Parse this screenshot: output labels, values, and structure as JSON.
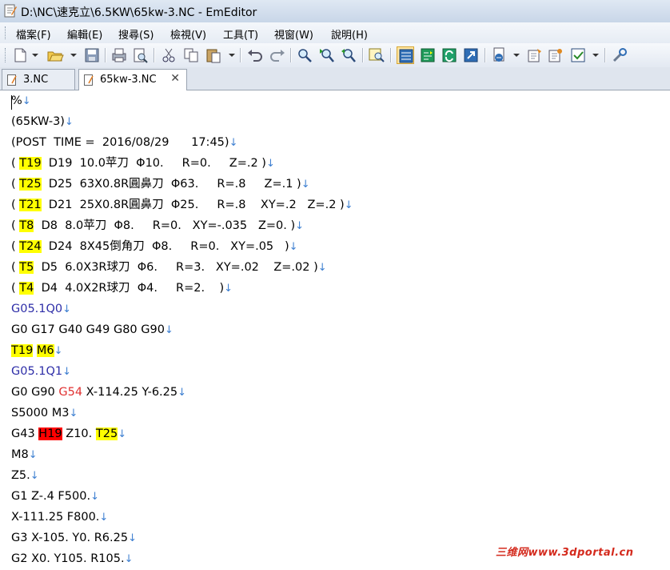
{
  "window": {
    "title": "D:\\NC\\速克立\\6.5KW\\65kw-3.NC - EmEditor"
  },
  "menu": [
    "檔案(F)",
    "編輯(E)",
    "搜尋(S)",
    "檢視(V)",
    "工具(T)",
    "視窗(W)",
    "說明(H)"
  ],
  "toolbar": {
    "icons": [
      "new-file-icon",
      "open-folder-icon",
      "save-icon",
      "print-icon",
      "print-preview-icon",
      "cut-icon",
      "copy-icon",
      "paste-icon",
      "undo-icon",
      "redo-icon",
      "find-icon",
      "find-next-icon",
      "find-prev-icon",
      "highlight-icon",
      "word-wrap-icon",
      "tab-icon",
      "refresh-icon",
      "export-icon",
      "encoding-icon",
      "properties-icon",
      "macro-icon",
      "checkbox-icon",
      "tools-icon"
    ]
  },
  "tabs": [
    {
      "label": "3.NC",
      "active": false
    },
    {
      "label": "65kw-3.NC",
      "active": true,
      "close": "✕"
    }
  ],
  "editor": {
    "return_glyph": "↓",
    "lines": [
      [
        {
          "t": "%"
        }
      ],
      [
        {
          "t": "(65KW-3)"
        }
      ],
      [
        {
          "t": "(POST  TIME =  2016/08/29      17:45)"
        }
      ],
      [
        {
          "t": "( "
        },
        {
          "t": "T19",
          "s": "hy"
        },
        {
          "t": "  D19  10.0苹刀  Φ10.     R=0.     Z=.2 )"
        }
      ],
      [
        {
          "t": "( "
        },
        {
          "t": "T25",
          "s": "hy"
        },
        {
          "t": "  D25  63X0.8R圓鼻刀  Φ63.     R=.8     Z=.1 )"
        }
      ],
      [
        {
          "t": "( "
        },
        {
          "t": "T21",
          "s": "hy"
        },
        {
          "t": "  D21  25X0.8R圓鼻刀  Φ25.     R=.8    XY=.2   Z=.2 )"
        }
      ],
      [
        {
          "t": "( "
        },
        {
          "t": "T8",
          "s": "hy"
        },
        {
          "t": "  D8  8.0苹刀  Φ8.     R=0.   XY=-.035   Z=0. )"
        }
      ],
      [
        {
          "t": "( "
        },
        {
          "t": "T24",
          "s": "hy"
        },
        {
          "t": "  D24  8X45倒角刀  Φ8.     R=0.   XY=.05   )"
        }
      ],
      [
        {
          "t": "( "
        },
        {
          "t": "T5",
          "s": "hy"
        },
        {
          "t": "  D5  6.0X3R球刀  Φ6.     R=3.   XY=.02    Z=.02 )"
        }
      ],
      [
        {
          "t": "( "
        },
        {
          "t": "T4",
          "s": "hy"
        },
        {
          "t": "  D4  4.0X2R球刀  Φ4.     R=2.    )"
        }
      ],
      [
        {
          "t": "G05.1Q0",
          "s": "cb"
        }
      ],
      [
        {
          "t": "G0 G17 G40 G49 G80 G90"
        }
      ],
      [
        {
          "t": "T19",
          "s": "hy"
        },
        {
          "t": " "
        },
        {
          "t": "M6",
          "s": "hy"
        }
      ],
      [
        {
          "t": "G05.1Q1",
          "s": "cb"
        }
      ],
      [
        {
          "t": "G0 G90 "
        },
        {
          "t": "G54",
          "s": "cr"
        },
        {
          "t": " X-114.25 Y-6.25"
        }
      ],
      [
        {
          "t": "S5000 M3"
        }
      ],
      [
        {
          "t": "G43 "
        },
        {
          "t": "H19",
          "s": "hr"
        },
        {
          "t": " Z10. "
        },
        {
          "t": "T25",
          "s": "hy"
        }
      ],
      [
        {
          "t": "M8"
        }
      ],
      [
        {
          "t": "Z5."
        }
      ],
      [
        {
          "t": "G1 Z-.4 F500."
        }
      ],
      [
        {
          "t": "X-111.25 F800."
        }
      ],
      [
        {
          "t": "G3 X-105. Y0. R6.25"
        }
      ],
      [
        {
          "t": "G2 X0. Y105. R105."
        }
      ]
    ]
  },
  "watermark": "三维网www.3dportal.cn"
}
